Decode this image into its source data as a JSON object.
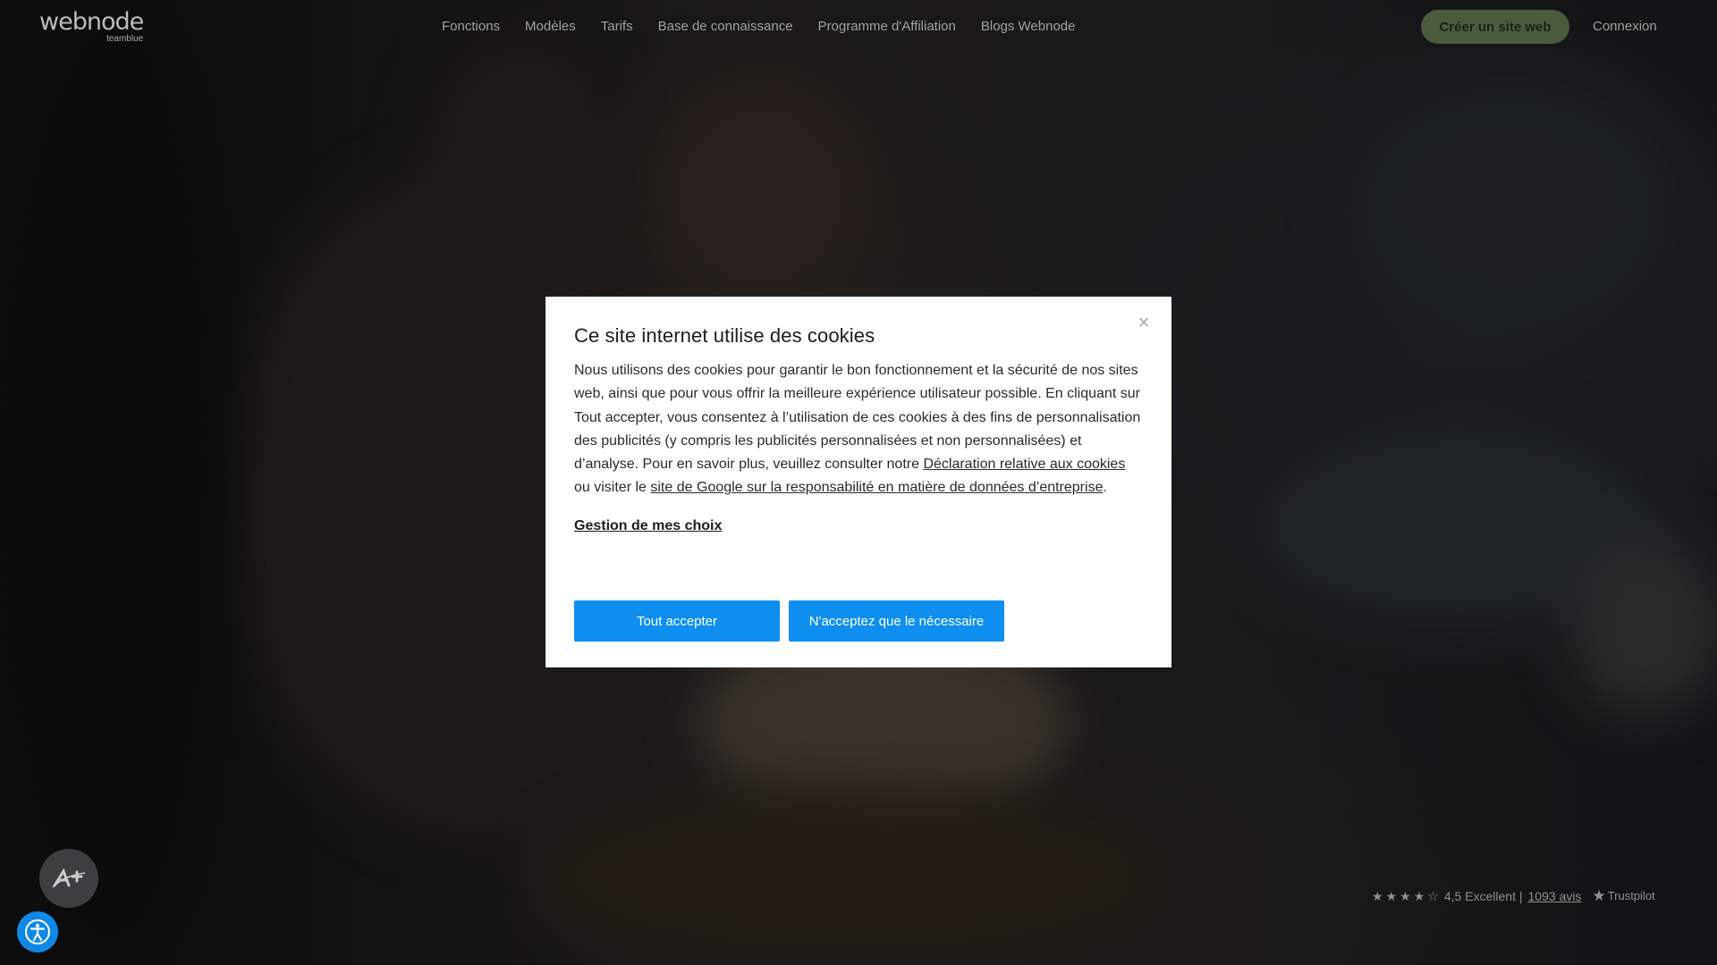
{
  "header": {
    "logo_text": "webnode",
    "logo_sub": "teamblue",
    "nav": [
      "Fonctions",
      "Modèles",
      "Tarifs",
      "Base de connaissance",
      "Programme d'Affiliation",
      "Blogs Webnode"
    ],
    "cta_label": "Créer un site web",
    "login_label": "Connexion"
  },
  "cookie_modal": {
    "title": "Ce site internet utilise des cookies",
    "close_glyph": "×",
    "body_part1": "Nous utilisons des cookies pour garantir le bon fonctionnement et la sécurité de nos sites web, ainsi que pour vous offrir la meilleure expérience utilisateur possible. En cliquant sur Tout accepter, vous consentez à l’utilisation de ces cookies à des fins de personnalisation des publicités (y compris les publicités personnalisées et non personnalisées) et d’analyse. Pour en savoir plus, veuillez consulter notre ",
    "link1": "Déclaration relative aux cookies",
    "body_part2": " ou visiter le ",
    "link2": "site de Google sur la responsabilité en matière de données d’entreprise",
    "body_part3": ".",
    "manage_label": "Gestion de mes choix",
    "accept_label": "Tout accepter",
    "necessary_label": "N'acceptez que le nécessaire",
    "button_color": "#0f8ff0"
  },
  "widgets": {
    "badge_icon": "a-plus-badge-icon",
    "accessibility_icon": "accessibility-icon"
  },
  "trustpilot": {
    "rating_text": "4,5 Excellent |",
    "reviews_link": "1093 avis",
    "brand": "Trustpilot"
  },
  "colors": {
    "cta_bg": "#4c5a3d",
    "accessibility_bg": "#1188e6"
  }
}
